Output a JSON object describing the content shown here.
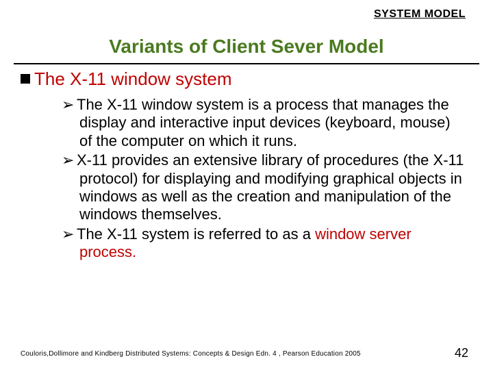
{
  "header_label": "SYSTEM MODEL",
  "title": "Variants of Client Sever Model",
  "subheading": "The X-11 window system",
  "bullets": [
    {
      "text": "The X-11 window system is a process that manages the display and interactive input devices (keyboard, mouse) of the computer on which it runs.",
      "tail_red": ""
    },
    {
      "text": "X-11 provides an extensive library of procedures (the X-11 protocol) for displaying and modifying graphical objects in windows as well as the creation and manipulation of the windows themselves.",
      "tail_red": ""
    },
    {
      "text": "The X-11 system is referred to as a ",
      "tail_red": "window server process."
    }
  ],
  "footer_citation": "Couloris,Dollimore and Kindberg  Distributed Systems: Concepts & Design  Edn. 4 , Pearson Education 2005",
  "page_number": "42",
  "arrow_glyph": "➢"
}
